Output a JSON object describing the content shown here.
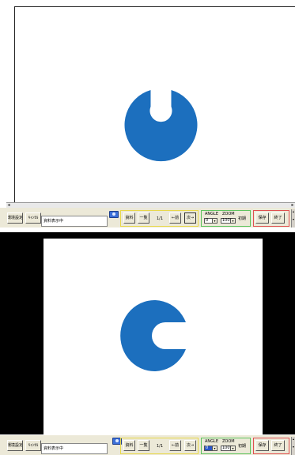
{
  "toolbar": {
    "env_settings_label": "環境設定",
    "cancel_label": "ｷｬﾝｾﾙ",
    "status_text": "資料表示中",
    "material_label": "資料",
    "list_label": "一覧",
    "page_label": "1/1",
    "prev_label": "←前",
    "next_label": "次→",
    "angle_label": "ANGLE",
    "zoom_label": "ZOOM",
    "angle_value": "0",
    "zoom_value": "100%",
    "reset_label": "初期",
    "save_label": "保存",
    "exit_label": "終了"
  },
  "colors": {
    "glyph_blue": "#1c6fbe",
    "nav_group_border": "#e8d84a",
    "angle_group_border": "#5ec45e",
    "exit_group_border": "#e05050"
  },
  "images": {
    "panel1_glyph": "rotated letter C",
    "panel2_glyph": "letter C"
  }
}
